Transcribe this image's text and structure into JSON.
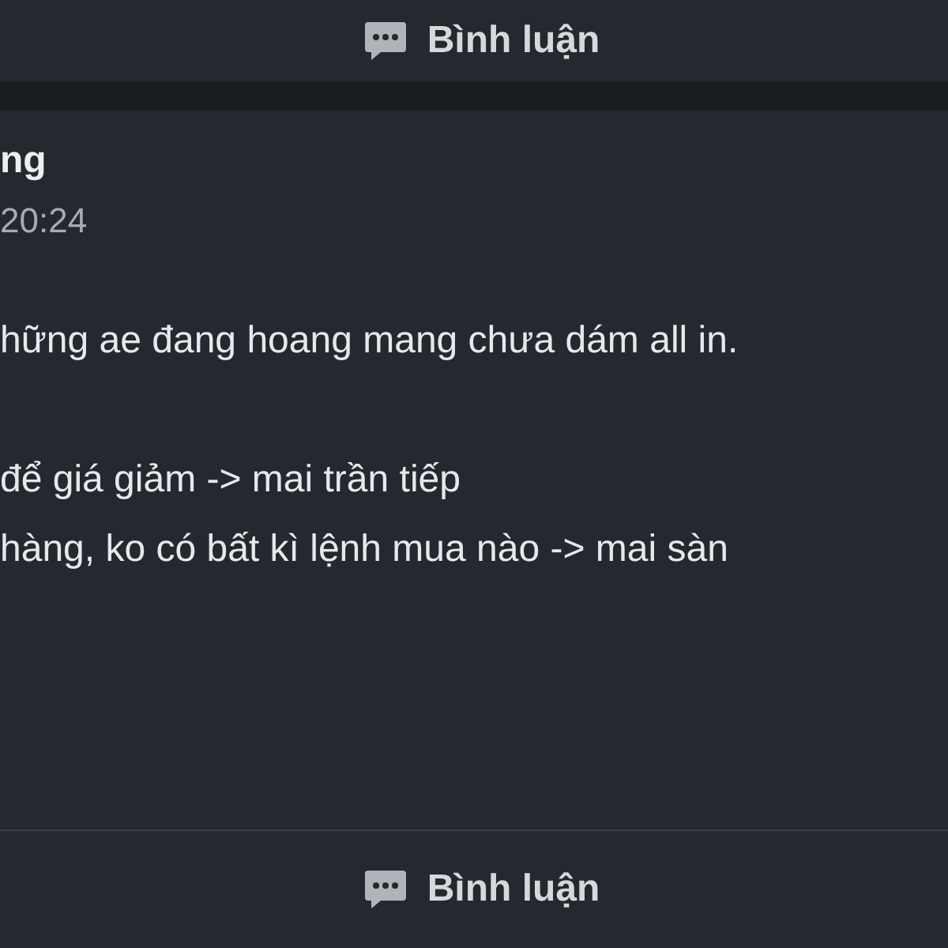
{
  "top_action": {
    "label": "Bình luận"
  },
  "post": {
    "author": "ng",
    "time": "20:24",
    "paragraphs": [
      [
        "hững ae đang hoang mang chưa dám all in."
      ],
      [
        "để giá giảm -> mai trần tiếp",
        "hàng, ko có bất kì lệnh mua nào -> mai sàn"
      ]
    ]
  },
  "bottom_action": {
    "label": "Bình luận"
  }
}
